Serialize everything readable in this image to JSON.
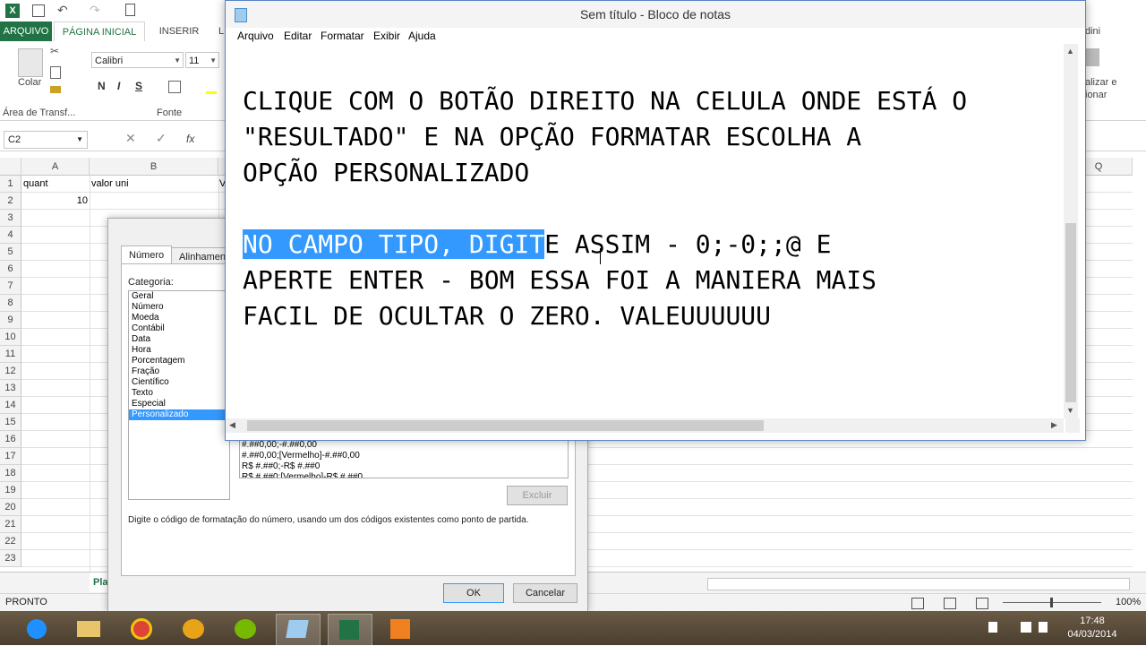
{
  "excel": {
    "tabs": {
      "arquivo": "ARQUIVO",
      "pagina_inicial": "PÁGINA INICIAL",
      "inserir": "INSERIR",
      "partial": "L"
    },
    "ribbon": {
      "colar": "Colar",
      "area_transf": "Área de Transf...",
      "font_name": "Calibri",
      "font_size": "11",
      "bold": "N",
      "italic": "I",
      "underline": "S",
      "fonte_group": "Fonte",
      "right_text_1": "alizar e",
      "right_text_2": "ionar",
      "user": "dini"
    },
    "namebox": "C2",
    "fx": "fx",
    "columns": [
      "A",
      "B"
    ],
    "col_partial_v": "V",
    "col_q": "Q",
    "rows": [
      "1",
      "2",
      "3",
      "4",
      "5",
      "6",
      "7",
      "8",
      "9",
      "10",
      "11",
      "12",
      "13",
      "14",
      "15",
      "16",
      "17",
      "18",
      "19",
      "20",
      "21",
      "22",
      "23"
    ],
    "cells": {
      "a1": "quant",
      "b1": "valor uni",
      "a2": "10"
    },
    "sheet_tab": "Pla",
    "status_left": "PRONTO",
    "zoom": "100%"
  },
  "dialog": {
    "tabs": {
      "numero": "Número",
      "alinhamento": "Alinhament"
    },
    "categoria_label": "Categoria:",
    "categories": [
      "Geral",
      "Número",
      "Moeda",
      "Contábil",
      "Data",
      "Hora",
      "Porcentagem",
      "Fração",
      "Científico",
      "Texto",
      "Especial",
      "Personalizado"
    ],
    "selected_category": "Personalizado",
    "types": [
      "#.##0,00;-#.##0,00",
      "#.##0,00;[Vermelho]-#.##0,00",
      "R$ #.##0;-R$ #.##0",
      "R$ #.##0;[Vermelho]-R$ #.##0"
    ],
    "excluir": "Excluir",
    "description": "Digite o código de formatação do número, usando um dos códigos existentes como ponto de partida.",
    "ok": "OK",
    "cancelar": "Cancelar"
  },
  "notepad": {
    "title": "Sem título - Bloco de notas",
    "menu": [
      "Arquivo",
      "Editar",
      "Formatar",
      "Exibir",
      "Ajuda"
    ],
    "text_part1": "CLIQUE COM O BOTÃO DIREITO NA CELULA ONDE ESTÁ O\n\"RESULTADO\" E NA OPÇÃO FORMATAR ESCOLHA A\nOPÇÃO PERSONALIZADO\n\n",
    "text_highlight": "NO CAMPO TIPO, DIGIT",
    "text_part2": "E ASSIM - 0;-0;;@ E\nAPERTE ENTER - BOM ESSA FOI A MANIERA MAIS\nFACIL DE OCULTAR O ZERO. VALEUUUUUU"
  },
  "taskbar": {
    "time": "17:48",
    "date": "04/03/2014"
  }
}
